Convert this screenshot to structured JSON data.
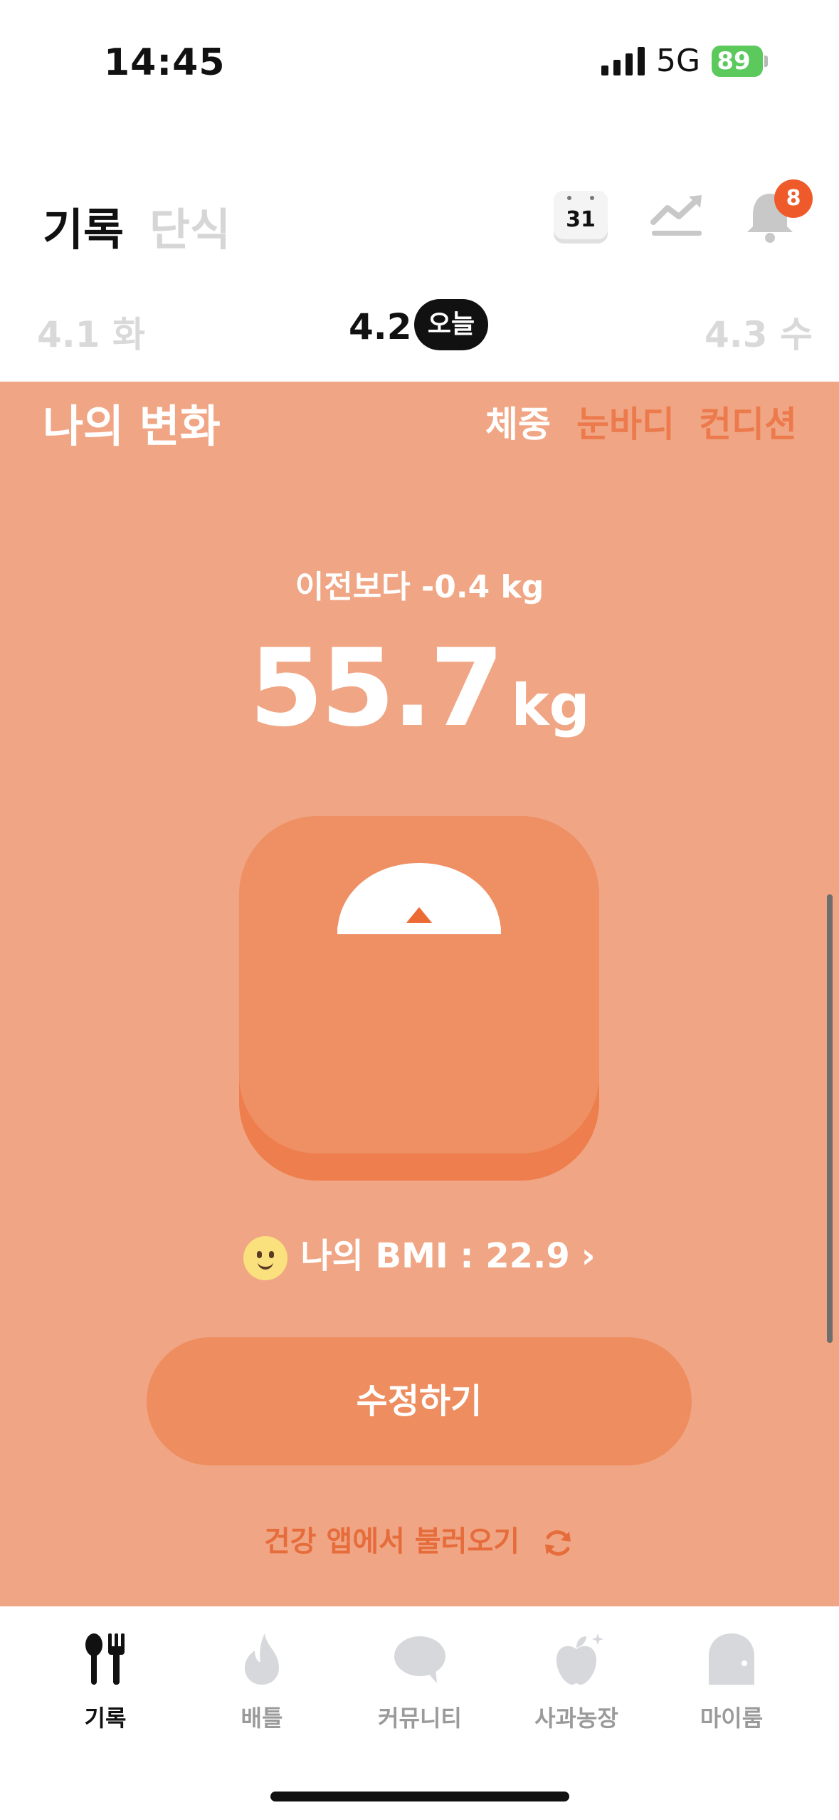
{
  "status_bar": {
    "time": "14:45",
    "network": "5G",
    "battery": "89"
  },
  "header": {
    "tabs": [
      {
        "label": "기록",
        "active": true
      },
      {
        "label": "단식",
        "active": false
      }
    ],
    "calendar_day": "31",
    "notification_count": "8",
    "icons": [
      "calendar-icon",
      "trend-chart-icon",
      "bell-icon"
    ]
  },
  "dates": {
    "prev": "4.1 화",
    "current": "4.2",
    "today_label": "오늘",
    "next": "4.3 수"
  },
  "main": {
    "title": "나의 변화",
    "tabs": [
      {
        "label": "체중",
        "active": true
      },
      {
        "label": "눈바디",
        "active": false
      },
      {
        "label": "컨디션",
        "active": false
      }
    ],
    "diff_text": "이전보다 -0.4 kg",
    "weight_value": "55.7",
    "weight_unit": "kg",
    "bmi_text": "나의 BMI : 22.9",
    "edit_label": "수정하기",
    "import_label": "건강 앱에서 불러오기"
  },
  "nav": {
    "items": [
      {
        "label": "기록",
        "icon": "fork-spoon-icon",
        "active": true
      },
      {
        "label": "배틀",
        "icon": "flame-icon",
        "active": false
      },
      {
        "label": "커뮤니티",
        "icon": "chat-bubble-icon",
        "active": false
      },
      {
        "label": "사과농장",
        "icon": "apple-icon",
        "active": false
      },
      {
        "label": "마이룸",
        "icon": "door-icon",
        "active": false
      }
    ]
  },
  "colors": {
    "accent": "#f0a684",
    "accent_dark": "#ec7a4c",
    "badge": "#ef5a2a",
    "battery": "#5cc95c"
  }
}
